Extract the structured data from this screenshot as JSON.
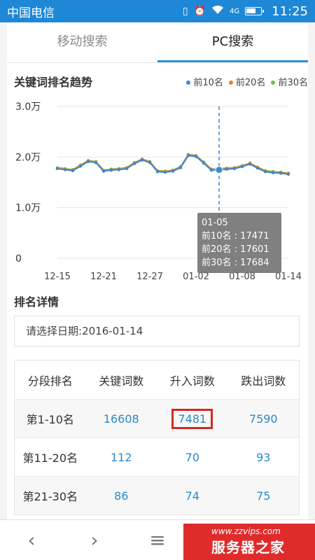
{
  "statusbar": {
    "carrier": "中国电信",
    "network": "4G",
    "time": "11:25",
    "battery_level": 0.7
  },
  "tabs": [
    {
      "label": "移动搜索"
    },
    {
      "label": "PC搜索"
    }
  ],
  "trend": {
    "title": "关键词排名趋势",
    "legend": [
      {
        "label": "前10名",
        "color": "#3a8ad0"
      },
      {
        "label": "前20名",
        "color": "#f07a2c"
      },
      {
        "label": "前30名",
        "color": "#6cc04a"
      }
    ]
  },
  "chart_data": {
    "type": "line",
    "x": [
      "12-15",
      "12-16",
      "12-17",
      "12-18",
      "12-19",
      "12-20",
      "12-21",
      "12-22",
      "12-23",
      "12-24",
      "12-25",
      "12-26",
      "12-27",
      "12-28",
      "12-29",
      "12-30",
      "12-31",
      "01-01",
      "01-02",
      "01-03",
      "01-04",
      "01-05",
      "01-06",
      "01-07",
      "01-08",
      "01-09",
      "01-10",
      "01-11",
      "01-12",
      "01-13",
      "01-14"
    ],
    "tick_labels": [
      "12-15",
      "12-21",
      "12-27",
      "01-02",
      "01-08",
      "01-14"
    ],
    "y_tick_labels": [
      "0",
      "1.0万",
      "2.0万",
      "3.0万"
    ],
    "ylim": [
      0,
      30000
    ],
    "grid": true,
    "series": [
      {
        "name": "前10名",
        "color": "#3a8ad0",
        "values": [
          17700,
          17500,
          17300,
          18200,
          19100,
          18900,
          17200,
          17400,
          17500,
          17700,
          18700,
          19400,
          18900,
          17100,
          17000,
          17200,
          17900,
          20300,
          20100,
          18800,
          17400,
          17471,
          17600,
          17700,
          18100,
          18600,
          17800,
          17100,
          16900,
          16800,
          16600
        ]
      },
      {
        "name": "前20名",
        "color": "#f07a2c",
        "values": [
          17820,
          17630,
          17430,
          18330,
          19230,
          19030,
          17330,
          17530,
          17630,
          17830,
          18830,
          19530,
          19030,
          17230,
          17130,
          17330,
          18030,
          20430,
          20230,
          18930,
          17530,
          17601,
          17730,
          17830,
          18230,
          18730,
          17930,
          17230,
          17030,
          16930,
          16730
        ]
      },
      {
        "name": "前30名",
        "color": "#6cc04a",
        "values": [
          17900,
          17710,
          17510,
          18410,
          19310,
          19110,
          17410,
          17610,
          17710,
          17910,
          18910,
          19610,
          19110,
          17310,
          17210,
          17410,
          18110,
          20510,
          20310,
          19010,
          17610,
          17684,
          17810,
          17910,
          18310,
          18810,
          18010,
          17310,
          17110,
          17010,
          16810
        ]
      }
    ],
    "tooltip": {
      "date": "01-05",
      "lines": [
        "前10名 : 17471",
        "前20名 : 17601",
        "前30名 : 17684"
      ]
    },
    "hover_index": 21
  },
  "detail": {
    "title": "排名详情",
    "date_prompt": "请选择日期:",
    "date_value": "2016-01-14",
    "headers": [
      "分段排名",
      "关键词数",
      "升入词数",
      "跌出词数"
    ],
    "rows": [
      [
        "第1-10名",
        "16608",
        "7481",
        "7590"
      ],
      [
        "第11-20名",
        "112",
        "70",
        "93"
      ],
      [
        "第21-30名",
        "86",
        "74",
        "75"
      ]
    ]
  },
  "watermark": {
    "url": "www.zzvips.com",
    "brand": "服务器之家"
  }
}
